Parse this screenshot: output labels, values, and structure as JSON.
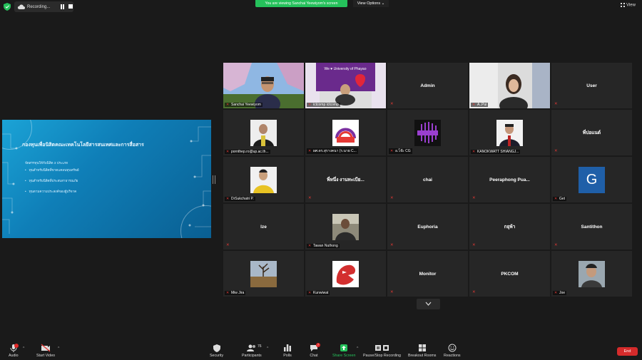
{
  "top": {
    "recording_label": "Recording...",
    "banner": "You are viewing Sanchai Yeewiyom's screen",
    "view_options": "View Options",
    "view_label": "View"
  },
  "slide": {
    "title": "กองทุนเพื่อนิสิตคณะเทคโนโลยีสารสนเทศและการสื่อสาร",
    "subtitle": "จัดสรรทุนให้กับนิสิต 3 ประเภท",
    "bullets": [
      "ทุนสำหรับนิสิตที่ขาดแคลนทุนทรัพย์",
      "ทุนสำหรับนิสิตที่ประสบสาธารณภัย",
      "ทุนตามความประสงค์ของผู้บริจาค"
    ]
  },
  "tiles": {
    "t1": "Sanchai Yeewiyom",
    "t2": "ictcomp ictcomp",
    "t3": "Admin",
    "t4": "A..Pui",
    "t5": "User",
    "t6": "pornthep.ro@up.ac.th...",
    "t7": "ผศ.ดร.สุรางคนา (ร.นาย C...",
    "t8": "อ.โจ๊ะ CG",
    "t9": "KANOKWATT SHIANGJ...",
    "t10": "พี่ปอแนด์",
    "t11": "DrSukchatri P.",
    "t12": "พี่หนึ่ง งานทะเบีย...",
    "t13": "chai",
    "t14": "Peeraphong  Pua...",
    "t15": "Get",
    "t16": "Ize",
    "t17": "Tawan Nuthong",
    "t18": "Euphoria",
    "t19": "กยุพ้า",
    "t20": "Santithon",
    "t21": "Miw Jira",
    "t22": "Kunwiwat",
    "t23": "Monitor",
    "t24": "PKCOM",
    "t25": "Joe"
  },
  "avatar_g": "G",
  "toolbar": {
    "audio": "Audio",
    "start_video": "Start Video",
    "security": "Security",
    "participants": "Participants",
    "participants_count": "76",
    "polls": "Polls",
    "chat": "Chat",
    "chat_badge": "7",
    "share_screen": "Share Screen",
    "recording": "Pause/Stop Recording",
    "breakout": "Breakout Rooms",
    "reactions": "Reactions",
    "end": "End"
  },
  "colors": {
    "share_green": "#25c15b",
    "end_red": "#d52b2b",
    "active_border": "#e3d32a"
  }
}
